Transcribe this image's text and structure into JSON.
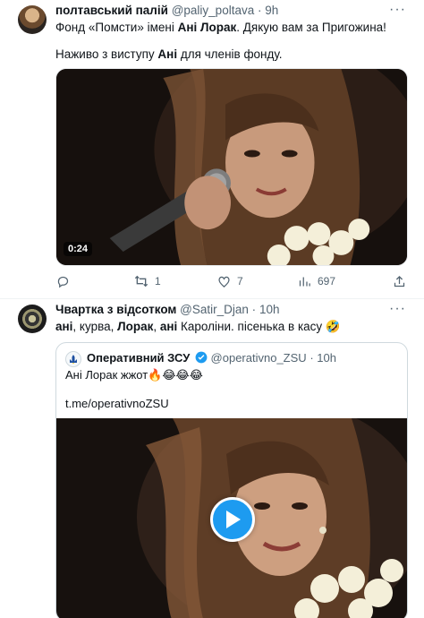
{
  "tweet1": {
    "author_name": "полтавський палій",
    "handle": "@paliy_poltava",
    "separator": "·",
    "time": "9h",
    "line1_a": "Фонд «Помсти» імені ",
    "line1_b": "Ані Лорак",
    "line1_c": ". Дякую вам за Пригожина!",
    "line2_a": "Наживо з виступу ",
    "line2_b": "Ані",
    "line2_c": " для членів фонду.",
    "video_timestamp": "0:24",
    "replies": "",
    "retweets": "1",
    "likes": "7",
    "views": "697"
  },
  "tweet2": {
    "author_name": "Чвартка з відсотком",
    "handle": "@Satir_Djan",
    "separator": "·",
    "time": "10h",
    "text_a": "ані",
    "text_b": ", курва, ",
    "text_c": "Лорак",
    "text_d": ", ",
    "text_e": "ані",
    "text_f": " Кароліни. пісенька в касу 🤣",
    "quote": {
      "author_name": "Оперативний ЗСУ",
      "handle": "@operativno_ZSU",
      "separator": "·",
      "time": "10h",
      "text": "Ані Лорак жжот🔥😂😂😂",
      "link": "t.me/operativnoZSU"
    }
  },
  "colors": {
    "text": "#0f1419",
    "muted": "#536471",
    "accent": "#1d9bf0",
    "border": "#cfd9de"
  }
}
